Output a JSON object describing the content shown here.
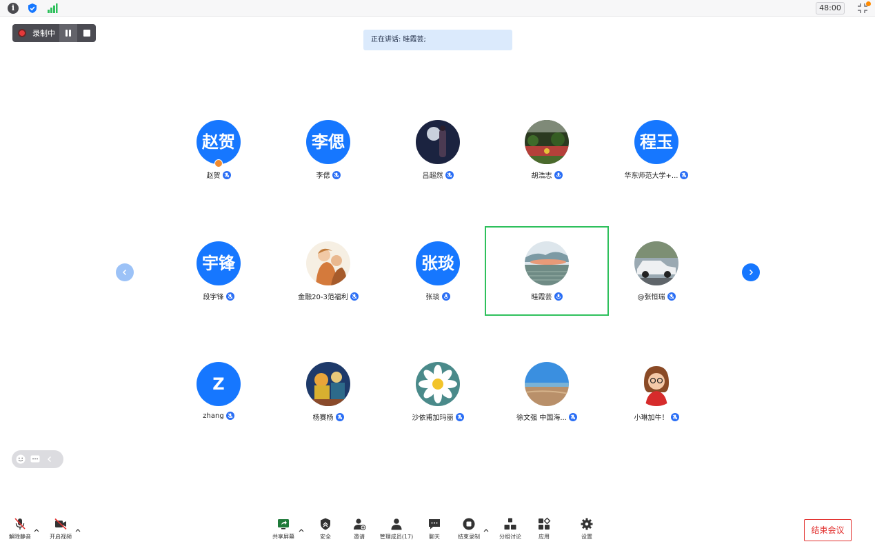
{
  "topbar": {
    "timer": "48:00"
  },
  "recording": {
    "label": "录制中"
  },
  "banner": {
    "text": "正在讲话: 眭霞芸;"
  },
  "participants": [
    {
      "name": "赵贺",
      "avatar_text": "赵贺",
      "mic": "muted",
      "host": true
    },
    {
      "name": "李偲",
      "avatar_text": "李偲",
      "mic": "muted"
    },
    {
      "name": "吕超然",
      "avatar_image": "night-photo",
      "mic": "muted"
    },
    {
      "name": "胡浩志",
      "avatar_image": "garden-photo",
      "mic": "on"
    },
    {
      "name": "华东师范大学+...",
      "avatar_text": "程玉",
      "mic": "muted"
    },
    {
      "name": "段宇锋",
      "avatar_text": "宇锋",
      "mic": "muted"
    },
    {
      "name": "金融20-3范福利",
      "avatar_image": "illustration",
      "mic": "muted"
    },
    {
      "name": "张琰",
      "avatar_text": "张琰",
      "mic": "on"
    },
    {
      "name": "眭霞芸",
      "avatar_image": "landscape-photo",
      "mic": "on",
      "active_speaker": true
    },
    {
      "name": "@张恒瑞",
      "avatar_image": "car-photo",
      "mic": "muted"
    },
    {
      "name": "zhang",
      "avatar_text": "Z",
      "mic": "muted"
    },
    {
      "name": "杨赛杨",
      "avatar_image": "cartoon",
      "mic": "muted"
    },
    {
      "name": "沙依甫加玛丽",
      "avatar_image": "daisy-photo",
      "mic": "muted"
    },
    {
      "name": "徐文强 中国海...",
      "avatar_image": "beach-photo",
      "mic": "muted"
    },
    {
      "name": "小琳加牛！",
      "avatar_image": "cartoon-woman",
      "mic": "muted"
    }
  ],
  "toolbar": {
    "unmute": "解除静音",
    "start_video": "开启视频",
    "share_screen": "共享屏幕",
    "security": "安全",
    "invite": "邀请",
    "manage_members": "管理成员(17)",
    "chat": "聊天",
    "end_recording": "结束录制",
    "breakout": "分组讨论",
    "apps": "应用",
    "settings": "设置",
    "end_meeting": "结束会议"
  },
  "colors": {
    "accent": "#1677ff",
    "active_speaker_border": "#2ec05c",
    "end_meeting": "#e2302e"
  }
}
